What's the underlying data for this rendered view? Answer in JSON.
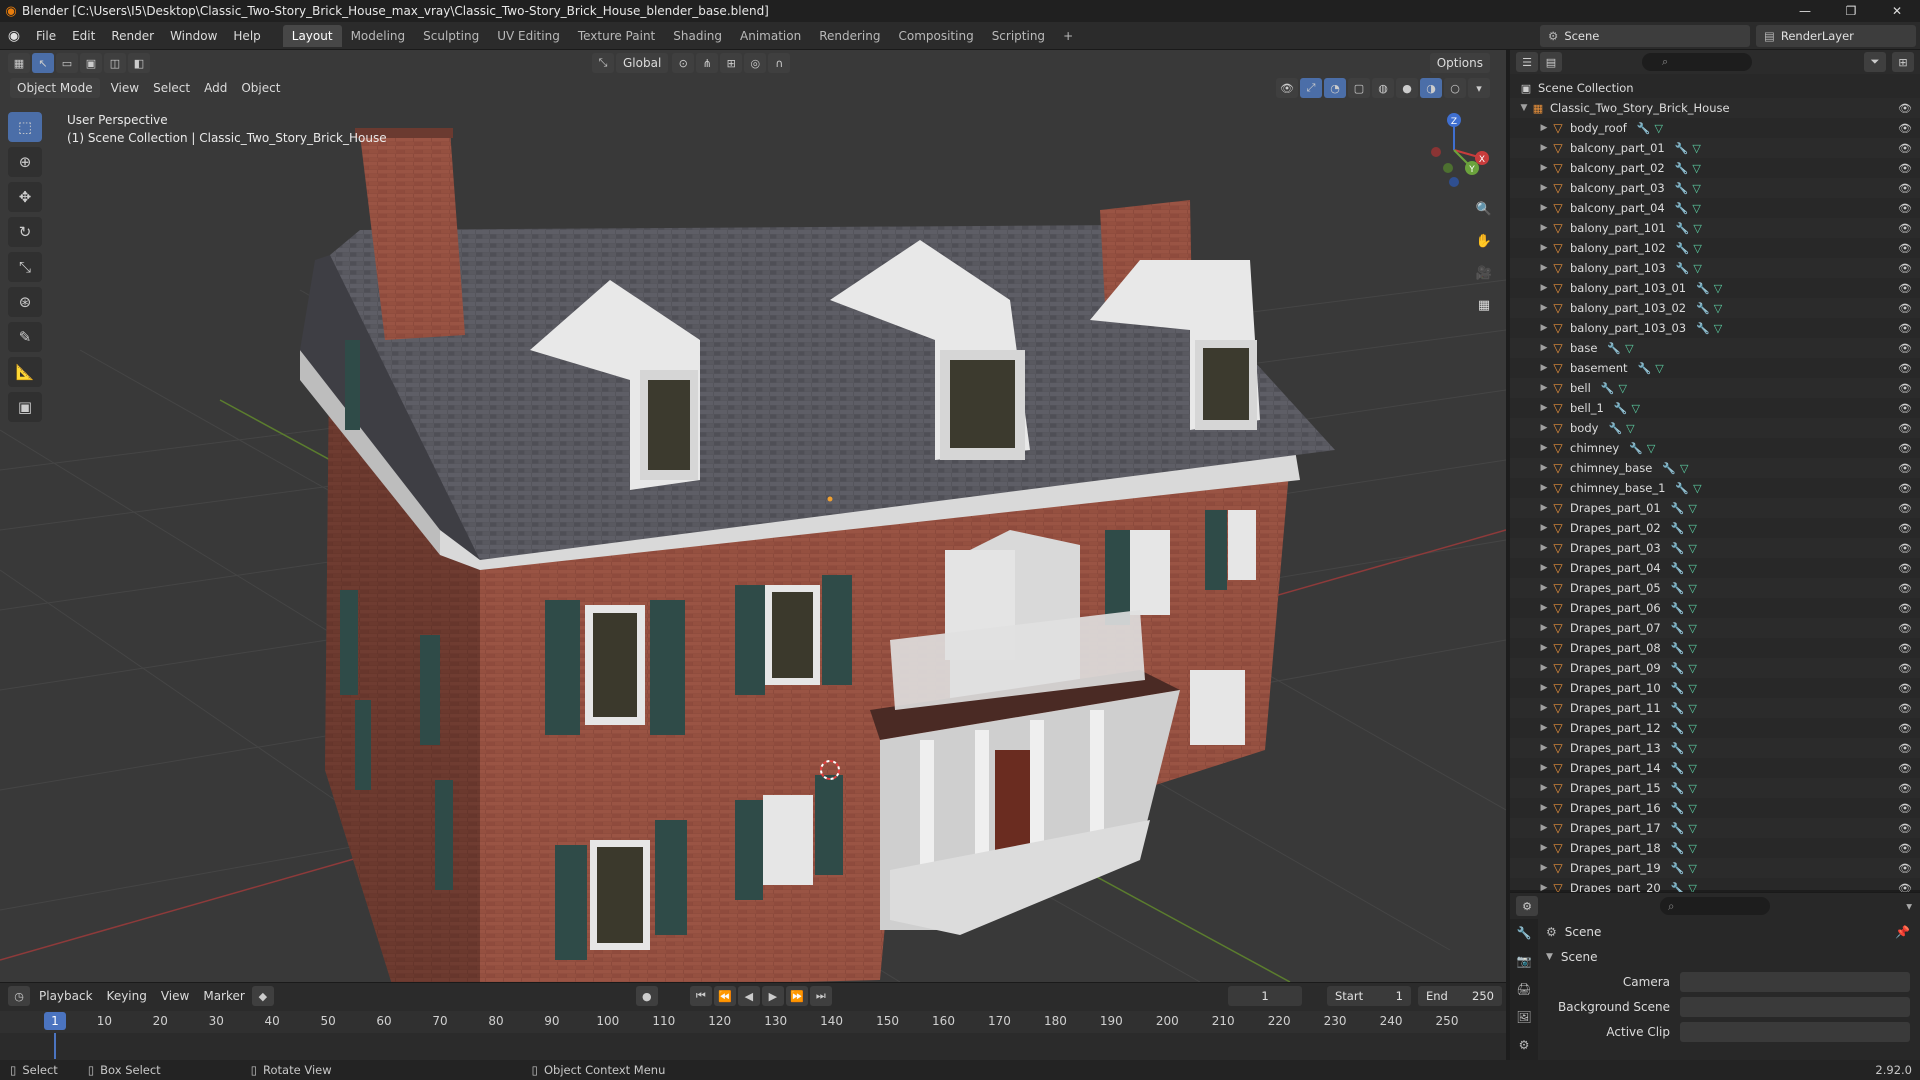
{
  "window": {
    "title": "Blender [C:\\Users\\I5\\Desktop\\Classic_Two-Story_Brick_House_max_vray\\Classic_Two-Story_Brick_House_blender_base.blend]",
    "controls": [
      "—",
      "❐",
      "✕"
    ]
  },
  "menu": [
    "File",
    "Edit",
    "Render",
    "Window",
    "Help"
  ],
  "workspaces": [
    "Layout",
    "Modeling",
    "Sculpting",
    "UV Editing",
    "Texture Paint",
    "Shading",
    "Animation",
    "Rendering",
    "Compositing",
    "Scripting"
  ],
  "active_workspace": "Layout",
  "add_workspace": "+",
  "scene_name": "Scene",
  "render_layer": "RenderLayer",
  "viewport": {
    "transform_orientation": "Global",
    "options_label": "Options",
    "mode": "Object Mode",
    "header_menu": [
      "View",
      "Select",
      "Add",
      "Object"
    ],
    "info_line1": "User Perspective",
    "info_line2": "(1) Scene Collection | Classic_Two_Story_Brick_House",
    "gizmo_axes": [
      "Z",
      "X",
      "Y"
    ]
  },
  "outliner": {
    "root": "Scene Collection",
    "collection": "Classic_Two_Story_Brick_House",
    "objects": [
      "body_roof",
      "balcony_part_01",
      "balcony_part_02",
      "balcony_part_03",
      "balcony_part_04",
      "balony_part_101",
      "balony_part_102",
      "balony_part_103",
      "balony_part_103_01",
      "balony_part_103_02",
      "balony_part_103_03",
      "base",
      "basement",
      "bell",
      "bell_1",
      "body",
      "chimney",
      "chimney_base",
      "chimney_base_1",
      "Drapes_part_01",
      "Drapes_part_02",
      "Drapes_part_03",
      "Drapes_part_04",
      "Drapes_part_05",
      "Drapes_part_06",
      "Drapes_part_07",
      "Drapes_part_08",
      "Drapes_part_09",
      "Drapes_part_10",
      "Drapes_part_11",
      "Drapes_part_12",
      "Drapes_part_13",
      "Drapes_part_14",
      "Drapes_part_15",
      "Drapes_part_16",
      "Drapes_part_17",
      "Drapes_part_18",
      "Drapes_part_19",
      "Drapes_part_20"
    ]
  },
  "properties": {
    "context": "Scene",
    "panel": "Scene",
    "fields": [
      "Camera",
      "Background Scene",
      "Active Clip"
    ]
  },
  "timeline": {
    "menu": [
      "Playback",
      "Keying",
      "View",
      "Marker"
    ],
    "current_frame": "1",
    "start_label": "Start",
    "start": "1",
    "end_label": "End",
    "end": "250",
    "ticks": [
      "10",
      "20",
      "30",
      "40",
      "50",
      "60",
      "70",
      "80",
      "90",
      "100",
      "110",
      "120",
      "130",
      "140",
      "150",
      "160",
      "170",
      "180",
      "190",
      "200",
      "210",
      "220",
      "230",
      "240",
      "250"
    ]
  },
  "statusbar": {
    "items": [
      "Select",
      "Box Select",
      "Rotate View",
      "Object Context Menu"
    ],
    "version": "2.92.0"
  }
}
